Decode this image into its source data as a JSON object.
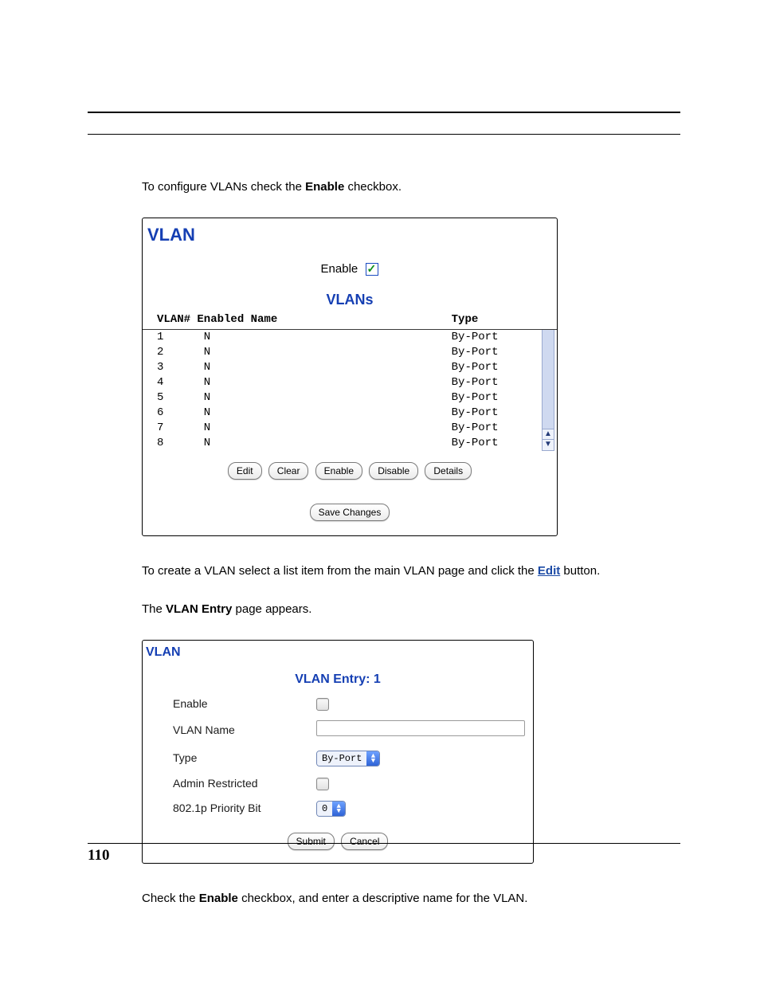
{
  "paragraphs": {
    "intro_prefix": "To configure VLANs check the ",
    "intro_bold": "Enable",
    "intro_suffix": " checkbox.",
    "mid_prefix": "To create a VLAN select a list item from the main VLAN page and click the ",
    "mid_link": "Edit",
    "mid_suffix": " button.",
    "appears_prefix": "The ",
    "appears_bold": "VLAN Entry",
    "appears_suffix": " page appears.",
    "final_prefix": "Check the ",
    "final_bold": "Enable",
    "final_suffix": " checkbox, and enter a descriptive name for the VLAN."
  },
  "panel1": {
    "title": "VLAN",
    "enable_label": "Enable",
    "subheading": "VLANs",
    "columns": "VLAN# Enabled Name                          Type",
    "rows": [
      "1      N                                    By-Port",
      "2      N                                    By-Port",
      "3      N                                    By-Port",
      "4      N                                    By-Port",
      "5      N                                    By-Port",
      "6      N                                    By-Port",
      "7      N                                    By-Port",
      "8      N                                    By-Port"
    ],
    "buttons": {
      "edit": "Edit",
      "clear": "Clear",
      "enable": "Enable",
      "disable": "Disable",
      "details": "Details",
      "save": "Save Changes"
    }
  },
  "panel2": {
    "title": "VLAN",
    "heading": "VLAN Entry: 1",
    "fields": {
      "enable": "Enable",
      "vlan_name": "VLAN Name",
      "type": "Type",
      "admin_restricted": "Admin Restricted",
      "priority": "802.1p Priority Bit"
    },
    "type_value": "By-Port",
    "priority_value": "0",
    "buttons": {
      "submit": "Submit",
      "cancel": "Cancel"
    }
  },
  "page_number": "110"
}
